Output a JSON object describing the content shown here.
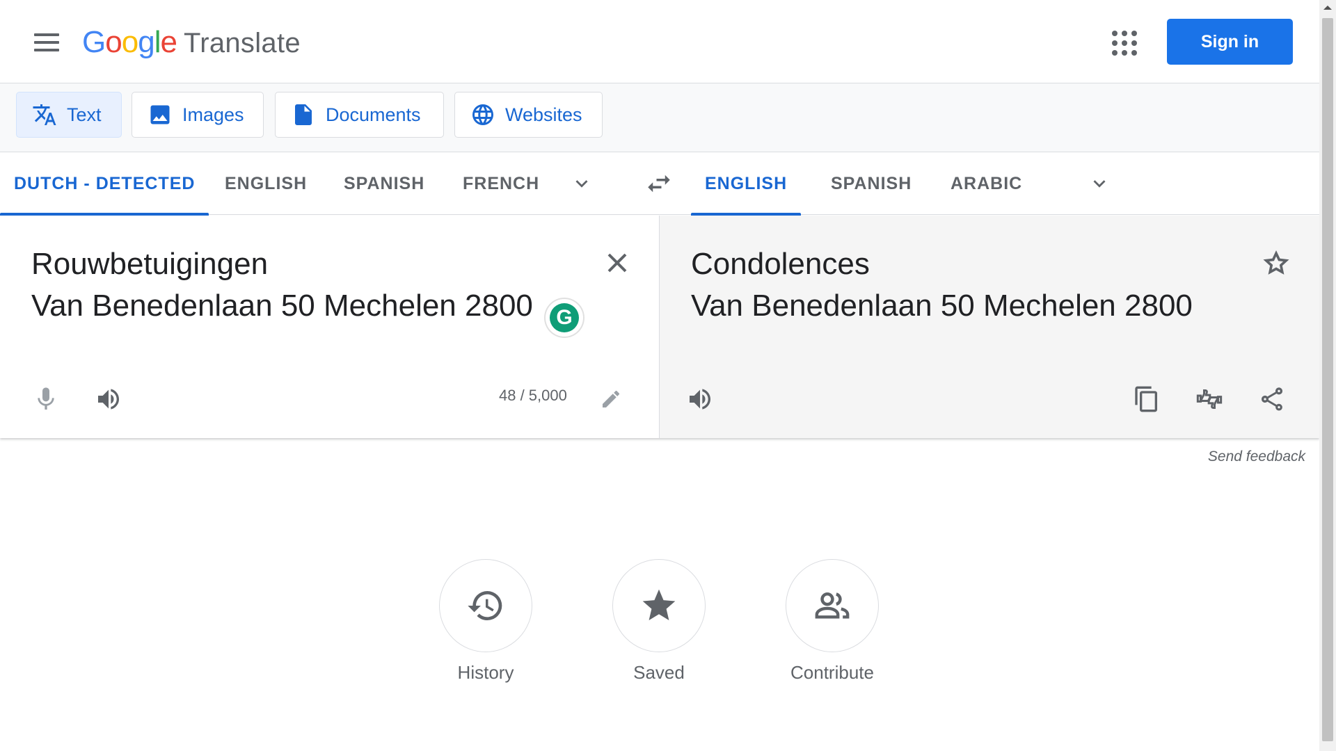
{
  "header": {
    "logo_letters": [
      "G",
      "o",
      "o",
      "g",
      "l",
      "e"
    ],
    "product_name": "Translate",
    "signin_label": "Sign in"
  },
  "colors": {
    "accent": "#1a73e8",
    "logo_blue": "#4285f4",
    "logo_red": "#ea4335",
    "logo_yellow": "#fbbc05",
    "logo_green": "#34a853"
  },
  "modes": [
    {
      "label": "Text",
      "icon": "translate-icon",
      "active": true
    },
    {
      "label": "Images",
      "icon": "image-icon",
      "active": false
    },
    {
      "label": "Documents",
      "icon": "document-icon",
      "active": false
    },
    {
      "label": "Websites",
      "icon": "globe-icon",
      "active": false
    }
  ],
  "source_languages": [
    "DUTCH - DETECTED",
    "ENGLISH",
    "SPANISH",
    "FRENCH"
  ],
  "target_languages": [
    "ENGLISH",
    "SPANISH",
    "ARABIC"
  ],
  "source": {
    "text": "Rouwbetuigingen\nVan Benedenlaan 50 Mechelen 2800",
    "char_count": "48 / 5,000"
  },
  "target": {
    "text": "Condolences\nVan Benedenlaan 50 Mechelen 2800"
  },
  "feedback_label": "Send feedback",
  "actions": [
    {
      "label": "History",
      "icon": "history-icon"
    },
    {
      "label": "Saved",
      "icon": "star-icon"
    },
    {
      "label": "Contribute",
      "icon": "people-icon"
    }
  ]
}
